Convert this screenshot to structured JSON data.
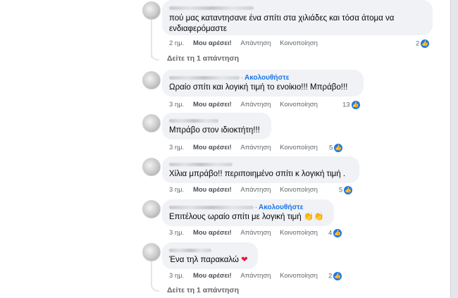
{
  "comments": [
    {
      "text": "πού μας καταντησανε ένα σπίτι στα χιλιάδες και τόσα άτομα να ενδιαφερόμαστε",
      "time": "2 ημ.",
      "reactions": "2"
    },
    {
      "follow": "Ακολουθήστε",
      "text": "Ωραίο σπίτι και λογική τιμή το ενοίκιο!!! Μπράβο!!!",
      "time": "3 ημ.",
      "reactions": "13"
    },
    {
      "text": "Μπράβο στον ιδιοκτήτη!!!",
      "time": "3 ημ.",
      "reactions": "5"
    },
    {
      "text": "Χίλια μπράβο!! περιποιημένο σπίτι κ λογική τιμή .",
      "time": "3 ημ.",
      "reactions": "5"
    },
    {
      "follow": "Ακολουθήστε",
      "text": "Επιτέλους ωραίο σπίτι με λογική τιμή",
      "emoji": "👏👏",
      "time": "3 ημ.",
      "reactions": "4"
    },
    {
      "text": "Ένα τηλ παρακαλώ",
      "emoji": "❤",
      "time": "3 ημ.",
      "reactions": "2"
    }
  ],
  "labels": {
    "like": "Μου αρέσει!",
    "reply": "Απάντηση",
    "share": "Κοινοποίηση",
    "dot": "·",
    "like_icon": "👍"
  },
  "view_replies": "Δείτε τη 1 απάντηση",
  "colors": {
    "bubble": "#f0f2f5",
    "link": "#1b74e4",
    "like_icon": "#1877f2",
    "muted": "#65676b"
  }
}
